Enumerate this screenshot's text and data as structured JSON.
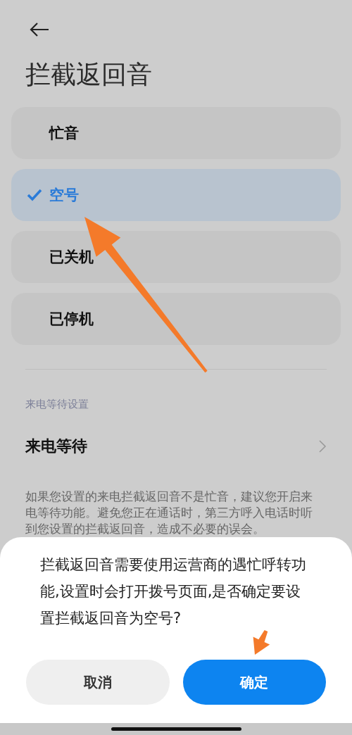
{
  "title": "拦截返回音",
  "options": [
    {
      "label": "忙音",
      "selected": false
    },
    {
      "label": "空号",
      "selected": true
    },
    {
      "label": "已关机",
      "selected": false
    },
    {
      "label": "已停机",
      "selected": false
    }
  ],
  "section_header": "来电等待设置",
  "setting_row": {
    "label": "来电等待"
  },
  "footnote": "如果您设置的来电拦截返回音不是忙音，建议您开启来电等待功能。避免您正在通话时，第三方呼入电话时听到您设置的拦截返回音，造成不必要的误会。",
  "dialog": {
    "message": "拦截返回音需要使用运营商的遇忙呼转功能,设置时会打开拨号页面,是否确定要设置拦截返回音为空号?",
    "buttons": [
      {
        "label": "取消",
        "kind": "secondary"
      },
      {
        "label": "确定",
        "kind": "primary"
      }
    ]
  }
}
